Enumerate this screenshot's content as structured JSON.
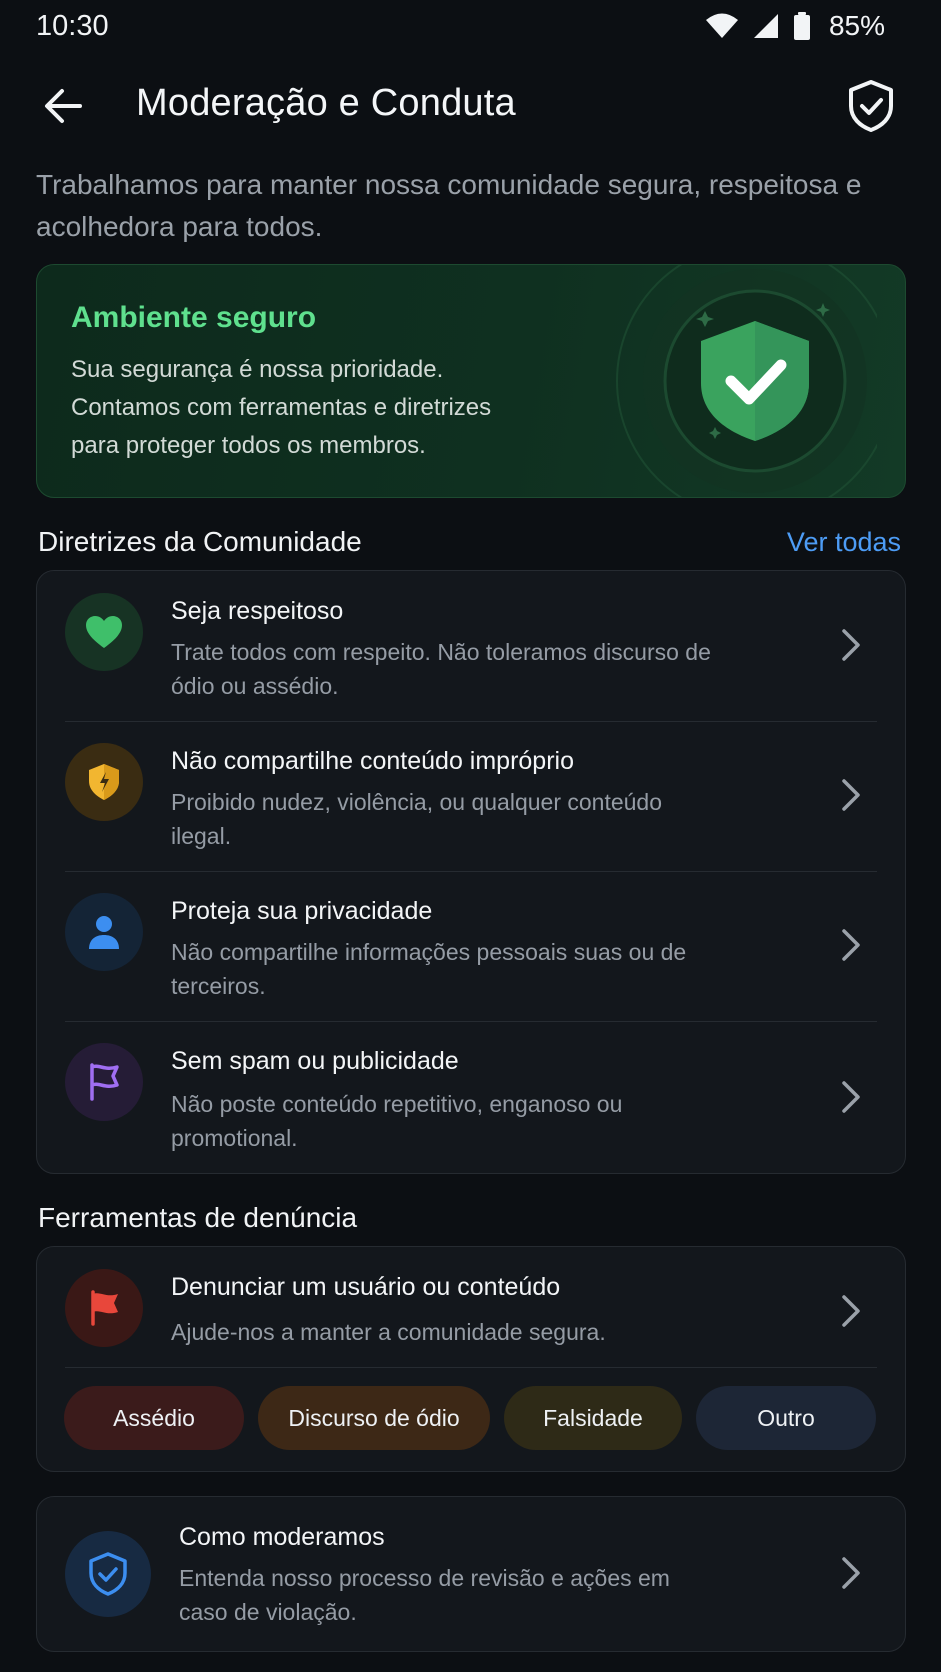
{
  "status": {
    "time": "10:30",
    "battery": "85%"
  },
  "header": {
    "title": "Moderação e Conduta"
  },
  "intro": "Trabalhamos para manter nossa comunidade segura, respeitosa e acolhedora para todos.",
  "hero": {
    "title": "Ambiente seguro",
    "text": "Sua segurança é nossa prioridade. Contamos com ferramentas e diretrizes para proteger todos os membros."
  },
  "guidelines": {
    "title": "Diretrizes da Comunidade",
    "see_all": "Ver todas",
    "items": [
      {
        "title": "Seja respeitoso",
        "desc": "Trate todos com respeito. Não toleramos discurso de ódio ou assédio.",
        "icon": "heart-icon",
        "color": "#3fbf6a"
      },
      {
        "title": "Não compartilhe conteúdo impróprio",
        "desc": "Proibido nudez, violência, ou qualquer conteúdo ilegal.",
        "icon": "shield-alert-icon",
        "color": "#f2b630"
      },
      {
        "title": "Proteja sua privacidade",
        "desc": "Não compartilhe informações pessoais suas ou de terceiros.",
        "icon": "person-icon",
        "color": "#3c8ef0"
      },
      {
        "title": "Sem spam ou publicidade",
        "desc": "Não poste conteúdo repetitivo, enganoso ou promotional.",
        "icon": "flag-icon",
        "color": "#a06ef2"
      }
    ]
  },
  "report": {
    "title": "Ferramentas de denúncia",
    "item": {
      "title": "Denunciar um usuário ou conteúdo",
      "desc": "Ajude-nos a manter a comunidade segura.",
      "icon": "red-flag-icon",
      "color": "#e8473b"
    },
    "chips": [
      "Assédio",
      "Discurso de ódio",
      "Falsidade",
      "Outro"
    ]
  },
  "moderation": {
    "title": "Como moderamos",
    "desc": "Entenda nosso processo de revisão e ações em caso de violação.",
    "icon": "shield-check-icon"
  }
}
